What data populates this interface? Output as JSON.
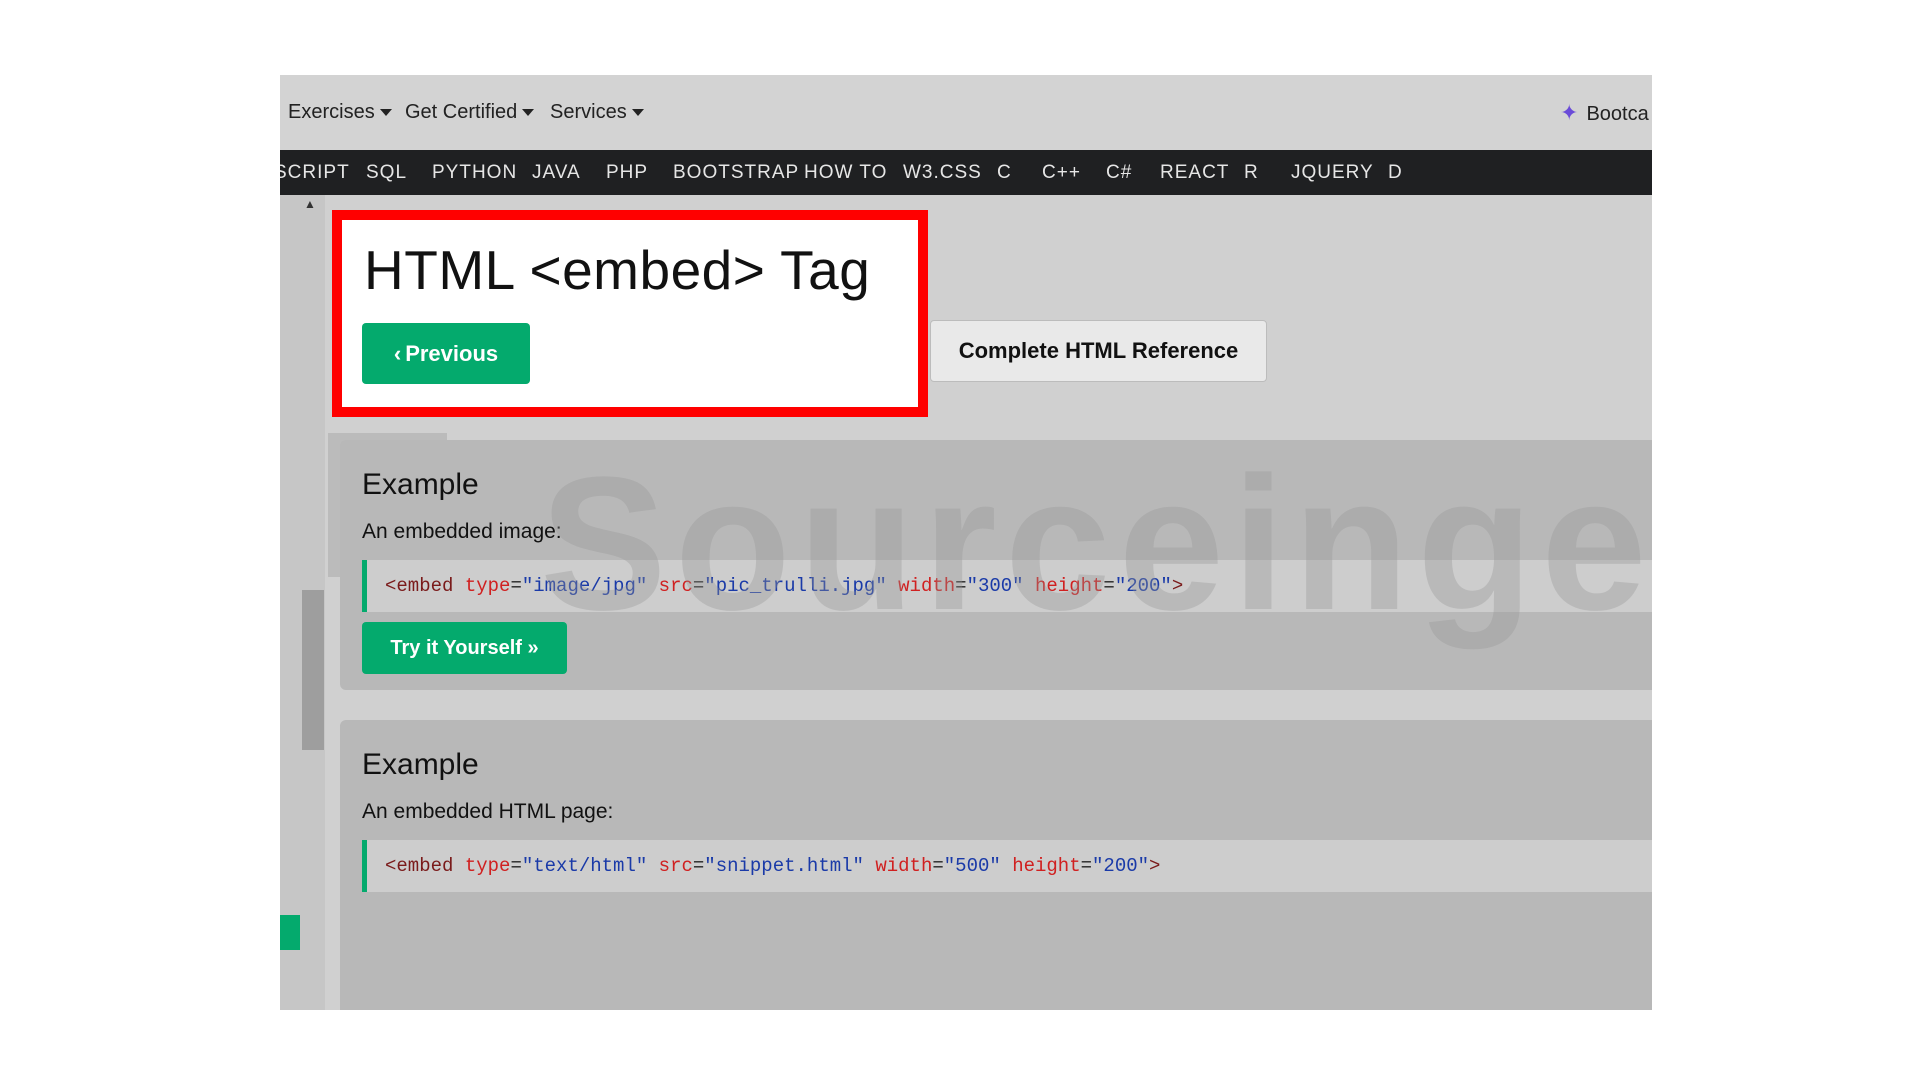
{
  "topbar": {
    "menus": [
      {
        "label": "Exercises"
      },
      {
        "label": "Get Certified"
      },
      {
        "label": "Services"
      }
    ],
    "bootcamp_label": "Bootca"
  },
  "navbar": {
    "links": [
      "SCRIPT",
      "SQL",
      "PYTHON",
      "JAVA",
      "PHP",
      "BOOTSTRAP",
      "HOW TO",
      "W3.CSS",
      "C",
      "C++",
      "C#",
      "REACT",
      "R",
      "JQUERY",
      "D"
    ]
  },
  "header": {
    "title": "HTML <embed> Tag",
    "previous_label": "Previous",
    "reference_label": "Complete HTML Reference"
  },
  "examples": [
    {
      "heading": "Example",
      "description": "An embedded image:",
      "code": {
        "tag_open": "<embed",
        "attrs": [
          {
            "name": "type",
            "value": "\"image/jpg\""
          },
          {
            "name": "src",
            "value": "\"pic_trulli.jpg\""
          },
          {
            "name": "width",
            "value": "\"300\""
          },
          {
            "name": "height",
            "value": "\"200\""
          }
        ],
        "tag_close": ">"
      },
      "try_label": "Try it Yourself »"
    },
    {
      "heading": "Example",
      "description": "An embedded HTML page:",
      "code": {
        "tag_open": "<embed",
        "attrs": [
          {
            "name": "type",
            "value": "\"text/html\""
          },
          {
            "name": "src",
            "value": "\"snippet.html\""
          },
          {
            "name": "width",
            "value": "\"500\""
          },
          {
            "name": "height",
            "value": "\"200\""
          }
        ],
        "tag_close": ">"
      }
    }
  ],
  "watermark": "Sourceinger",
  "colors": {
    "accent_green": "#04aa6d",
    "highlight_red": "#ff0000",
    "nav_dark": "#1f2022"
  }
}
